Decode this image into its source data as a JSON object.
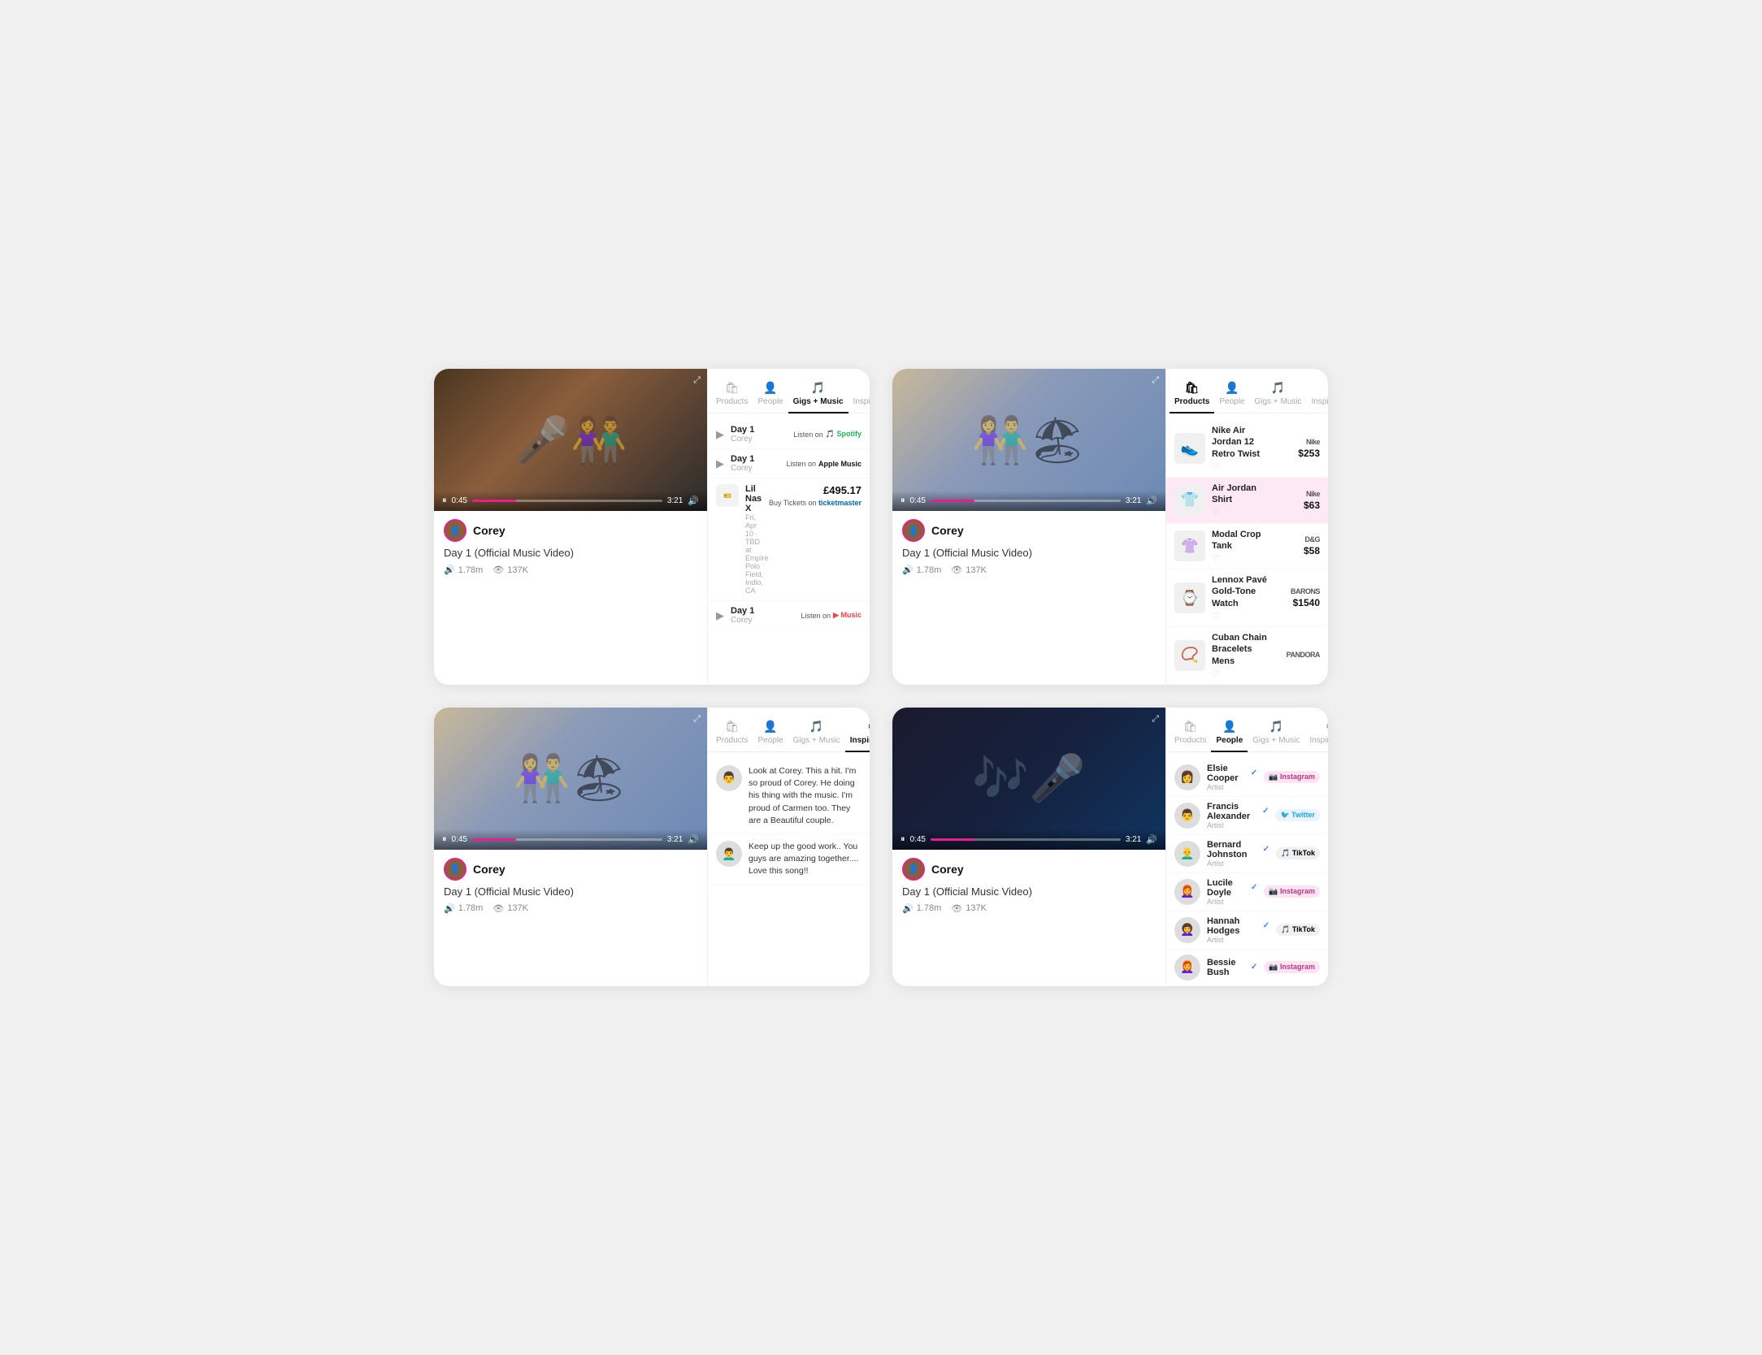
{
  "cards": [
    {
      "id": "card-top-left",
      "video": {
        "bg_class": "vid-bg-1",
        "time_current": "0:45",
        "time_end": "3:21",
        "progress_pct": 23
      },
      "artist": "Corey",
      "title": "Day 1 (Official Music Video)",
      "stats": {
        "plays": "1.78m",
        "views": "137K"
      },
      "active_tab": "gigs_music",
      "tabs": [
        {
          "id": "products",
          "label": "Products",
          "icon": "🛍"
        },
        {
          "id": "people",
          "label": "People",
          "icon": "👤"
        },
        {
          "id": "gigs_music",
          "label": "Gigs + Music",
          "icon": "🎵"
        },
        {
          "id": "inspirations",
          "label": "Inspirations",
          "icon": "⚙"
        }
      ],
      "gigs_music_items": [
        {
          "type": "music",
          "title": "Day 1",
          "artist": "Corey",
          "service": "spotify",
          "service_label": "Listen on",
          "service_brand": "Spotify"
        },
        {
          "type": "music",
          "title": "Day 1",
          "artist": "Corey",
          "service": "apple",
          "service_label": "Listen on",
          "service_brand": "Apple Music"
        },
        {
          "type": "gig",
          "date_label": "Fri, Apr 10",
          "artist": "Lil Nas X",
          "venue": "TBD at Empire Polo Field, Indio, CA",
          "price": "£495.17",
          "action": "Buy Tickets on",
          "action_brand": "ticketmaster"
        },
        {
          "type": "music",
          "title": "Day 1",
          "artist": "Corey",
          "service": "music",
          "service_label": "Listen on",
          "service_brand": "Music"
        }
      ]
    },
    {
      "id": "card-top-right",
      "video": {
        "bg_class": "vid-bg-2",
        "time_current": "0:45",
        "time_end": "3:21",
        "progress_pct": 23
      },
      "artist": "Corey",
      "title": "Day 1 (Official Music Video)",
      "stats": {
        "plays": "1.78m",
        "views": "137K"
      },
      "active_tab": "products",
      "tabs": [
        {
          "id": "products",
          "label": "Products",
          "icon": "🛍"
        },
        {
          "id": "people",
          "label": "People",
          "icon": "👤"
        },
        {
          "id": "gigs_music",
          "label": "Gigs + Music",
          "icon": "🎵"
        },
        {
          "id": "inspirations",
          "label": "Inspirations",
          "icon": "⚙"
        }
      ],
      "products": [
        {
          "name": "Nike Air Jordan 12 Retro Twist",
          "brand": "Nike",
          "price": "$253",
          "highlight": false,
          "emoji": "👟"
        },
        {
          "name": "Air Jordan Shirt",
          "brand": "Nike",
          "price": "$63",
          "highlight": true,
          "emoji": "👕"
        },
        {
          "name": "Modal Crop Tank",
          "brand": "D&G",
          "price": "$58",
          "highlight": false,
          "emoji": "👚"
        },
        {
          "name": "Lennox Pavé Gold-Tone Watch",
          "brand": "BARONS",
          "price": "$1540",
          "highlight": false,
          "emoji": "⌚"
        },
        {
          "name": "Cuban Chain Bracelets Mens",
          "brand": "PANDORA",
          "price": "",
          "highlight": false,
          "emoji": "📿"
        }
      ]
    },
    {
      "id": "card-bottom-left",
      "video": {
        "bg_class": "vid-bg-2",
        "time_current": "0:45",
        "time_end": "3:21",
        "progress_pct": 23
      },
      "artist": "Corey",
      "title": "Day 1 (Official Music Video)",
      "stats": {
        "plays": "1.78m",
        "views": "137K"
      },
      "active_tab": "inspirations",
      "tabs": [
        {
          "id": "products",
          "label": "Products",
          "icon": "🛍"
        },
        {
          "id": "people",
          "label": "People",
          "icon": "👤"
        },
        {
          "id": "gigs_music",
          "label": "Gigs + Music",
          "icon": "🎵"
        },
        {
          "id": "inspirations",
          "label": "Inspirations",
          "icon": "⚙"
        }
      ],
      "inspirations": [
        {
          "text": "Look at Corey. This a hit. I'm so proud of Corey. He doing his thing with the music. I'm proud of Carmen too. They are a Beautiful couple.",
          "avatar": "👨"
        },
        {
          "text": "Keep up the good work.. You guys are amazing together.... Love this song!!",
          "avatar": "👨‍🦱"
        }
      ]
    },
    {
      "id": "card-bottom-right",
      "video": {
        "bg_class": "vid-bg-3",
        "time_current": "0:45",
        "time_end": "3:21",
        "progress_pct": 23
      },
      "artist": "Corey",
      "title": "Day 1 (Official Music Video)",
      "stats": {
        "plays": "1.78m",
        "views": "137K"
      },
      "active_tab": "people",
      "tabs": [
        {
          "id": "products",
          "label": "Products",
          "icon": "🛍"
        },
        {
          "id": "people",
          "label": "People",
          "icon": "👤"
        },
        {
          "id": "gigs_music",
          "label": "Gigs + Music",
          "icon": "🎵"
        },
        {
          "id": "inspirations",
          "label": "Inspirations",
          "icon": "⚙"
        }
      ],
      "people": [
        {
          "name": "Elsie Cooper",
          "role": "Artist",
          "social": "instagram",
          "social_label": "Instagram",
          "verified": true,
          "avatar": "👩"
        },
        {
          "name": "Francis Alexander",
          "role": "Artist",
          "social": "twitter",
          "social_label": "Twitter",
          "verified": true,
          "avatar": "👨"
        },
        {
          "name": "Bernard Johnston",
          "role": "Artist",
          "social": "tiktok",
          "social_label": "TikTok",
          "verified": true,
          "avatar": "👨‍🦲"
        },
        {
          "name": "Lucile Doyle",
          "role": "Artist",
          "social": "instagram",
          "social_label": "Instagram",
          "verified": true,
          "avatar": "👩‍🦰"
        },
        {
          "name": "Hannah Hodges",
          "role": "Artist",
          "social": "tiktok",
          "social_label": "TikTok",
          "verified": true,
          "avatar": "👩‍🦱"
        },
        {
          "name": "Bessie Bush",
          "role": "",
          "social": "instagram",
          "social_label": "Instagram",
          "verified": true,
          "avatar": "👩‍🦰"
        }
      ]
    }
  ],
  "labels": {
    "listen_on": "Listen on",
    "buy_tickets_on": "Buy Tickets on",
    "plays_icon": "🔊",
    "views_icon": "👁"
  }
}
